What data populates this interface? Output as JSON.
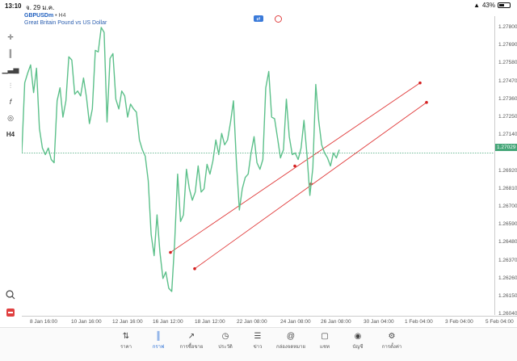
{
  "status_bar": {
    "time": "13:10",
    "date": "จ. 29 ม.ค.",
    "battery": "43%"
  },
  "symbol": {
    "name": "GBPUSDm",
    "timeframe": "H4",
    "description": "Great Britain Pound vs US Dollar"
  },
  "price_axis": {
    "ticks": [
      "1.27800",
      "1.27690",
      "1.27580",
      "1.27470",
      "1.27360",
      "1.27250",
      "1.27140",
      "1.26920",
      "1.26810",
      "1.26700",
      "1.26590",
      "1.26480",
      "1.26370",
      "1.26260",
      "1.26150",
      "1.26040"
    ],
    "current_price": "1.27029",
    "current_price_color": "#45a678"
  },
  "time_axis": {
    "ticks": [
      "8 Jan 16:00",
      "10 Jan 16:00",
      "12 Jan 16:00",
      "16 Jan 12:00",
      "18 Jan 12:00",
      "22 Jan 08:00",
      "24 Jan 08:00",
      "26 Jan 08:00",
      "30 Jan 04:00",
      "1 Feb 04:00",
      "3 Feb 04:00",
      "5 Feb 04:00"
    ]
  },
  "toolbar": {
    "tools": [
      "candles-icon",
      "indicators-icon",
      "settings-sliders-icon",
      "function-icon",
      "shapes-icon"
    ],
    "timeframe_label": "H4"
  },
  "chart_data": {
    "type": "line",
    "series_color": "#5cc08a",
    "channel_color": "#e03a3a",
    "ylim": [
      1.2598,
      1.2788
    ],
    "price_points": [
      1.2703,
      1.2746,
      1.2752,
      1.2757,
      1.274,
      1.2755,
      1.2718,
      1.2706,
      1.2702,
      1.2706,
      1.2699,
      1.2697,
      1.2735,
      1.2743,
      1.2725,
      1.2735,
      1.2762,
      1.276,
      1.2739,
      1.2741,
      1.2738,
      1.2749,
      1.2737,
      1.2721,
      1.273,
      1.2766,
      1.2765,
      1.278,
      1.2777,
      1.2722,
      1.2761,
      1.2764,
      1.2736,
      1.273,
      1.2741,
      1.2738,
      1.2725,
      1.2733,
      1.273,
      1.2728,
      1.2711,
      1.2705,
      1.2701,
      1.2686,
      1.2653,
      1.264,
      1.2665,
      1.2642,
      1.2626,
      1.263,
      1.262,
      1.2618,
      1.2648,
      1.269,
      1.2661,
      1.2665,
      1.2693,
      1.2681,
      1.2674,
      1.2679,
      1.2695,
      1.2679,
      1.2681,
      1.2696,
      1.269,
      1.2698,
      1.2711,
      1.2702,
      1.2715,
      1.2708,
      1.2711,
      1.2722,
      1.2735,
      1.2698,
      1.2668,
      1.2681,
      1.2688,
      1.269,
      1.2703,
      1.2713,
      1.2697,
      1.2693,
      1.2699,
      1.2743,
      1.2753,
      1.2725,
      1.2724,
      1.2712,
      1.27,
      1.2705,
      1.2736,
      1.2713,
      1.2702,
      1.2703,
      1.2699,
      1.2706,
      1.2723,
      1.2702,
      1.2677,
      1.2694,
      1.2745,
      1.2723,
      1.2708,
      1.2703,
      1.27,
      1.2695,
      1.2703,
      1.27,
      1.2705
    ],
    "channel_lines": [
      {
        "start": [
          1.2642
        ],
        "end": [
          1.2746
        ]
      },
      {
        "start": [
          1.2632
        ],
        "end": [
          1.2734
        ]
      }
    ]
  },
  "bottom_nav": [
    {
      "label": "ราคา",
      "icon": "quotes-icon"
    },
    {
      "label": "กราฟ",
      "icon": "chart-icon",
      "active": true
    },
    {
      "label": "การซื้อขาย",
      "icon": "trade-icon"
    },
    {
      "label": "ประวัติ",
      "icon": "history-icon"
    },
    {
      "label": "ข่าว",
      "icon": "news-icon"
    },
    {
      "label": "กล่องจดหมาย",
      "icon": "mailbox-icon"
    },
    {
      "label": "แชท",
      "icon": "chat-icon"
    },
    {
      "label": "บัญชี",
      "icon": "account-icon"
    },
    {
      "label": "การตั้งค่า",
      "icon": "settings-icon"
    }
  ]
}
